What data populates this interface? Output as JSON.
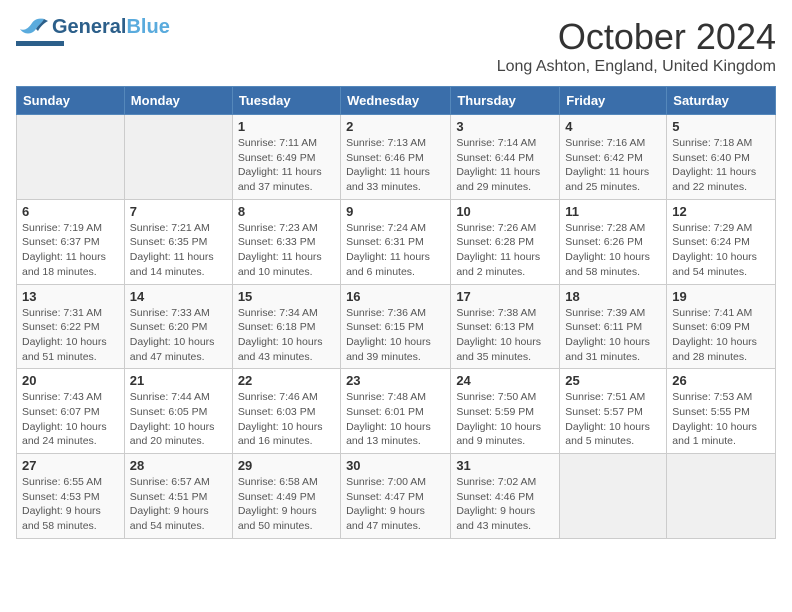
{
  "header": {
    "logo_general": "General",
    "logo_blue": "Blue",
    "month_title": "October 2024",
    "location": "Long Ashton, England, United Kingdom"
  },
  "days_of_week": [
    "Sunday",
    "Monday",
    "Tuesday",
    "Wednesday",
    "Thursday",
    "Friday",
    "Saturday"
  ],
  "weeks": [
    [
      {
        "day": "",
        "info": ""
      },
      {
        "day": "",
        "info": ""
      },
      {
        "day": "1",
        "info": "Sunrise: 7:11 AM\nSunset: 6:49 PM\nDaylight: 11 hours\nand 37 minutes."
      },
      {
        "day": "2",
        "info": "Sunrise: 7:13 AM\nSunset: 6:46 PM\nDaylight: 11 hours\nand 33 minutes."
      },
      {
        "day": "3",
        "info": "Sunrise: 7:14 AM\nSunset: 6:44 PM\nDaylight: 11 hours\nand 29 minutes."
      },
      {
        "day": "4",
        "info": "Sunrise: 7:16 AM\nSunset: 6:42 PM\nDaylight: 11 hours\nand 25 minutes."
      },
      {
        "day": "5",
        "info": "Sunrise: 7:18 AM\nSunset: 6:40 PM\nDaylight: 11 hours\nand 22 minutes."
      }
    ],
    [
      {
        "day": "6",
        "info": "Sunrise: 7:19 AM\nSunset: 6:37 PM\nDaylight: 11 hours\nand 18 minutes."
      },
      {
        "day": "7",
        "info": "Sunrise: 7:21 AM\nSunset: 6:35 PM\nDaylight: 11 hours\nand 14 minutes."
      },
      {
        "day": "8",
        "info": "Sunrise: 7:23 AM\nSunset: 6:33 PM\nDaylight: 11 hours\nand 10 minutes."
      },
      {
        "day": "9",
        "info": "Sunrise: 7:24 AM\nSunset: 6:31 PM\nDaylight: 11 hours\nand 6 minutes."
      },
      {
        "day": "10",
        "info": "Sunrise: 7:26 AM\nSunset: 6:28 PM\nDaylight: 11 hours\nand 2 minutes."
      },
      {
        "day": "11",
        "info": "Sunrise: 7:28 AM\nSunset: 6:26 PM\nDaylight: 10 hours\nand 58 minutes."
      },
      {
        "day": "12",
        "info": "Sunrise: 7:29 AM\nSunset: 6:24 PM\nDaylight: 10 hours\nand 54 minutes."
      }
    ],
    [
      {
        "day": "13",
        "info": "Sunrise: 7:31 AM\nSunset: 6:22 PM\nDaylight: 10 hours\nand 51 minutes."
      },
      {
        "day": "14",
        "info": "Sunrise: 7:33 AM\nSunset: 6:20 PM\nDaylight: 10 hours\nand 47 minutes."
      },
      {
        "day": "15",
        "info": "Sunrise: 7:34 AM\nSunset: 6:18 PM\nDaylight: 10 hours\nand 43 minutes."
      },
      {
        "day": "16",
        "info": "Sunrise: 7:36 AM\nSunset: 6:15 PM\nDaylight: 10 hours\nand 39 minutes."
      },
      {
        "day": "17",
        "info": "Sunrise: 7:38 AM\nSunset: 6:13 PM\nDaylight: 10 hours\nand 35 minutes."
      },
      {
        "day": "18",
        "info": "Sunrise: 7:39 AM\nSunset: 6:11 PM\nDaylight: 10 hours\nand 31 minutes."
      },
      {
        "day": "19",
        "info": "Sunrise: 7:41 AM\nSunset: 6:09 PM\nDaylight: 10 hours\nand 28 minutes."
      }
    ],
    [
      {
        "day": "20",
        "info": "Sunrise: 7:43 AM\nSunset: 6:07 PM\nDaylight: 10 hours\nand 24 minutes."
      },
      {
        "day": "21",
        "info": "Sunrise: 7:44 AM\nSunset: 6:05 PM\nDaylight: 10 hours\nand 20 minutes."
      },
      {
        "day": "22",
        "info": "Sunrise: 7:46 AM\nSunset: 6:03 PM\nDaylight: 10 hours\nand 16 minutes."
      },
      {
        "day": "23",
        "info": "Sunrise: 7:48 AM\nSunset: 6:01 PM\nDaylight: 10 hours\nand 13 minutes."
      },
      {
        "day": "24",
        "info": "Sunrise: 7:50 AM\nSunset: 5:59 PM\nDaylight: 10 hours\nand 9 minutes."
      },
      {
        "day": "25",
        "info": "Sunrise: 7:51 AM\nSunset: 5:57 PM\nDaylight: 10 hours\nand 5 minutes."
      },
      {
        "day": "26",
        "info": "Sunrise: 7:53 AM\nSunset: 5:55 PM\nDaylight: 10 hours\nand 1 minute."
      }
    ],
    [
      {
        "day": "27",
        "info": "Sunrise: 6:55 AM\nSunset: 4:53 PM\nDaylight: 9 hours\nand 58 minutes."
      },
      {
        "day": "28",
        "info": "Sunrise: 6:57 AM\nSunset: 4:51 PM\nDaylight: 9 hours\nand 54 minutes."
      },
      {
        "day": "29",
        "info": "Sunrise: 6:58 AM\nSunset: 4:49 PM\nDaylight: 9 hours\nand 50 minutes."
      },
      {
        "day": "30",
        "info": "Sunrise: 7:00 AM\nSunset: 4:47 PM\nDaylight: 9 hours\nand 47 minutes."
      },
      {
        "day": "31",
        "info": "Sunrise: 7:02 AM\nSunset: 4:46 PM\nDaylight: 9 hours\nand 43 minutes."
      },
      {
        "day": "",
        "info": ""
      },
      {
        "day": "",
        "info": ""
      }
    ]
  ]
}
